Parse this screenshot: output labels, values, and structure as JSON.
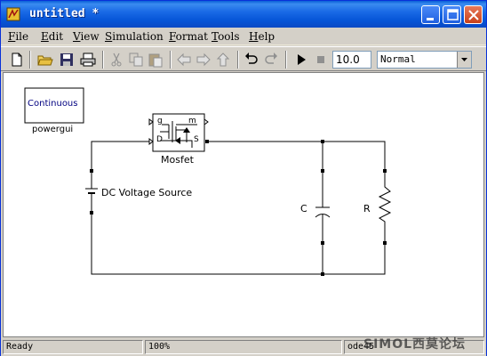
{
  "window": {
    "title": "untitled *",
    "controls": [
      "minimize",
      "maximize",
      "close"
    ]
  },
  "menu": [
    {
      "label": "File"
    },
    {
      "label": "Edit"
    },
    {
      "label": "View"
    },
    {
      "label": "Simulation"
    },
    {
      "label": "Format"
    },
    {
      "label": "Tools"
    },
    {
      "label": "Help"
    }
  ],
  "toolbar": {
    "icons": [
      "new-icon",
      "open-icon",
      "save-icon",
      "print-icon",
      "cut-icon",
      "copy-icon",
      "paste-icon",
      "back-icon",
      "forward-icon",
      "up-icon",
      "undo-icon",
      "redo-icon",
      "start-icon",
      "stop-icon"
    ],
    "stop_time": "10.0",
    "simulation_mode": "Normal"
  },
  "canvas": {
    "blocks": {
      "powergui_text": "Continuous",
      "powergui_name": "powergui",
      "mosfet_name": "Mosfet",
      "mosfet_port_g": "g",
      "mosfet_port_m": "m",
      "mosfet_port_d": "D",
      "mosfet_port_s": "S",
      "dc_source_name": "DC Voltage Source",
      "capacitor_name": "C",
      "resistor_name": "R"
    }
  },
  "status": {
    "state": "Ready",
    "zoom": "100%",
    "solver": "ode45"
  },
  "watermark": "SIMOL西莫论坛",
  "colors": {
    "titlebar": "#0a5fd8",
    "chrome": "#d4d0c8",
    "canvas": "#ffffff"
  }
}
